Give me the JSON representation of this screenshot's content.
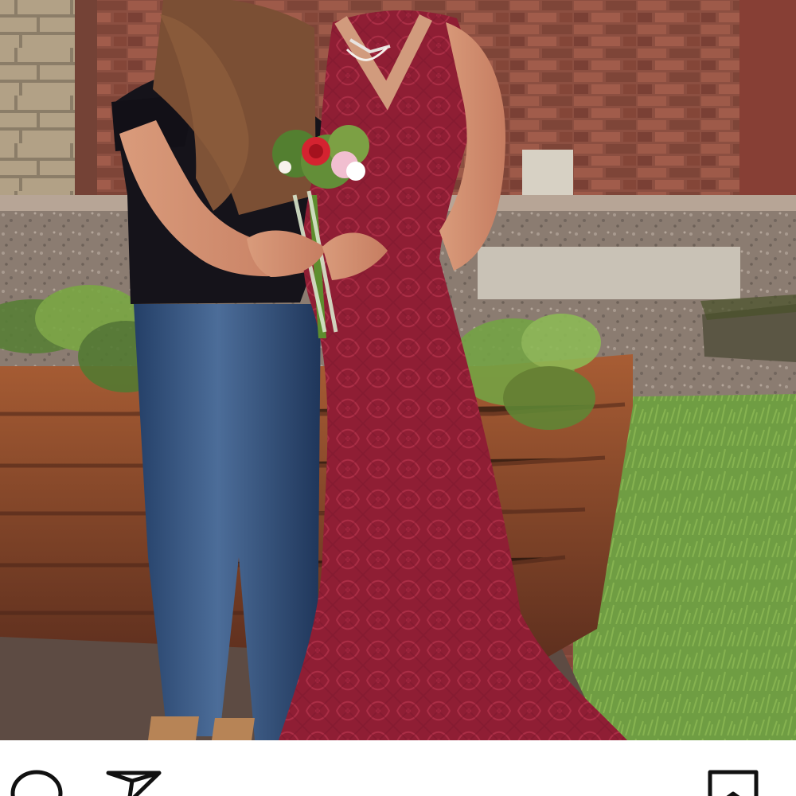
{
  "post": {
    "photo": {
      "subject": "two-people-bouquet-photo"
    },
    "actions": {
      "comment_icon": "comment-icon",
      "share_icon": "share-icon",
      "save_icon": "save-icon"
    }
  },
  "colors": {
    "background": "#ffffff",
    "icon": "#111111",
    "dress": "#8c1f33",
    "top": "#15131a",
    "jeans": "#2f4f7b",
    "brick": "#8f4f3f",
    "grass": "#6f9d43"
  }
}
